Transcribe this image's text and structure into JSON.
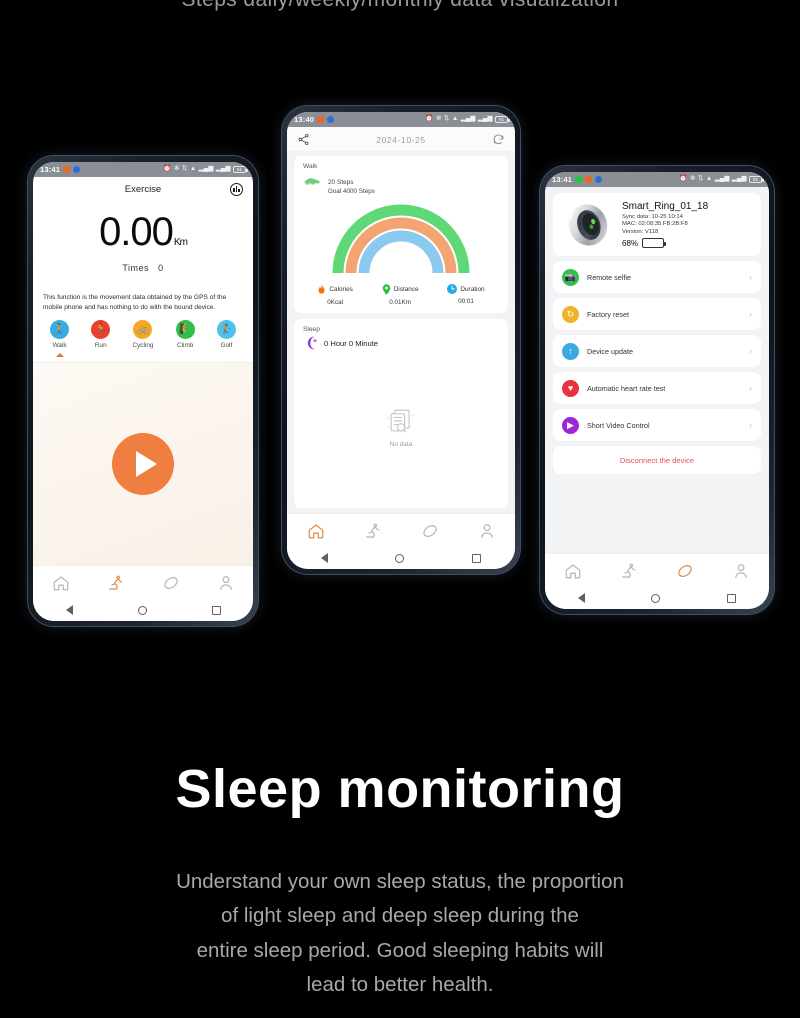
{
  "top_caption": "Steps daily/weekly/monthly data visualization",
  "headline": "Sleep monitoring",
  "subcopy": [
    "Understand your own sleep status, the proportion",
    "of light sleep and deep sleep during the",
    "entire sleep period. Good sleeping habits will",
    "lead to better health."
  ],
  "phone_left": {
    "status_bar": {
      "time": "13:41",
      "battery": "81"
    },
    "header": {
      "title": "Exercise",
      "chart_icon": "bar-chart-icon"
    },
    "distance_value": "0.00",
    "distance_unit": "Km",
    "times_label": "Times",
    "times_value": "0",
    "note": "This function is the movement data obtained by the GPS of the mobile phone and has nothing to do with the bound device.",
    "activities": [
      {
        "label": "Walk",
        "color": "#3aaae0",
        "glyph": "walk-icon",
        "selected": true
      },
      {
        "label": "Run",
        "color": "#e8422e",
        "glyph": "run-icon",
        "selected": false
      },
      {
        "label": "Cycling",
        "color": "#f5a623",
        "glyph": "cycling-icon",
        "selected": false
      },
      {
        "label": "Climb",
        "color": "#2fc04a",
        "glyph": "climb-icon",
        "selected": false
      },
      {
        "label": "Golf",
        "color": "#4ec3ef",
        "glyph": "golf-icon",
        "selected": false
      }
    ],
    "start_button": "play-icon",
    "tabs": [
      {
        "name": "home",
        "icon": "home-icon",
        "active": false
      },
      {
        "name": "exercise",
        "icon": "running-icon",
        "active": true
      },
      {
        "name": "device",
        "icon": "ring-icon",
        "active": false
      },
      {
        "name": "profile",
        "icon": "person-icon",
        "active": false
      }
    ]
  },
  "phone_mid": {
    "status_bar": {
      "time": "13:40",
      "battery": "81"
    },
    "header": {
      "share_icon": "share-icon",
      "date": "2024-10-25",
      "refresh_icon": "refresh-icon"
    },
    "walk_card": {
      "label": "Walk",
      "steps_value": "20",
      "steps_unit": "Steps",
      "goal": "Goal 4000 Steps",
      "arc_colors": [
        "#5fd877",
        "#f4a373",
        "#8cc9ef"
      ],
      "stats": [
        {
          "label": "Calories",
          "value": "0Kcal",
          "icon": "flame-icon",
          "color": "#f2720c"
        },
        {
          "label": "Distance",
          "value": "0.01Km",
          "icon": "location-pin-icon",
          "color": "#22c348"
        },
        {
          "label": "Duration",
          "value": "00:01",
          "icon": "clock-icon",
          "color": "#29a8e0"
        }
      ]
    },
    "sleep_card": {
      "label": "Sleep",
      "value": "0 Hour 0 Minute",
      "moon_icon": "moon-star-icon",
      "empty_label": "No data",
      "empty_icon": "no-data-icon"
    },
    "tabs": [
      {
        "name": "home",
        "icon": "home-icon",
        "active": true
      },
      {
        "name": "exercise",
        "icon": "running-icon",
        "active": false
      },
      {
        "name": "device",
        "icon": "ring-icon",
        "active": false
      },
      {
        "name": "profile",
        "icon": "person-icon",
        "active": false
      }
    ]
  },
  "phone_right": {
    "status_bar": {
      "time": "13:41",
      "battery": "81"
    },
    "device": {
      "image": "smart-ring-image",
      "name": "Smart_Ring_01_18",
      "sync": "Sync data: 10-25 10:14",
      "mac": "MAC: 02:08:35:FB:2B:F8",
      "version": "Version: V118",
      "battery_pct": "68%",
      "battery_level": 68
    },
    "menu": [
      {
        "label": "Remote selfie",
        "icon": "camera-icon",
        "color": "#2fc04a"
      },
      {
        "label": "Factory reset",
        "icon": "refresh-circle-icon",
        "color": "#f0b429"
      },
      {
        "label": "Device update",
        "icon": "upload-arrow-icon",
        "color": "#3aaae0"
      },
      {
        "label": "Automatic heart rate test",
        "icon": "heartbeat-icon",
        "color": "#e8323c"
      },
      {
        "label": "Short Video Control",
        "icon": "video-play-icon",
        "color": "#9c27d6"
      }
    ],
    "disconnect": "Disconnect the device",
    "tabs": [
      {
        "name": "home",
        "icon": "home-icon",
        "active": false
      },
      {
        "name": "exercise",
        "icon": "running-icon",
        "active": false
      },
      {
        "name": "device",
        "icon": "ring-icon",
        "active": true
      },
      {
        "name": "profile",
        "icon": "person-icon",
        "active": false
      }
    ]
  }
}
